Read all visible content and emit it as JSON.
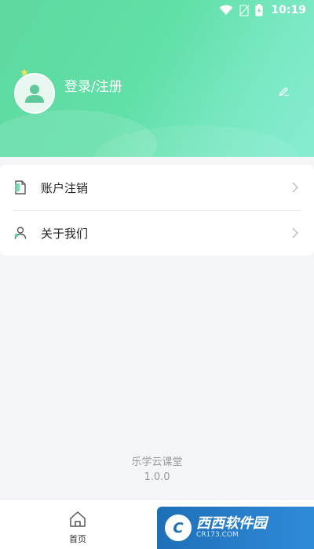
{
  "status": {
    "time": "10:19"
  },
  "profile": {
    "login_label": "登录/注册"
  },
  "menu": {
    "items": [
      {
        "label": "账户注销",
        "icon": "document-icon"
      },
      {
        "label": "关于我们",
        "icon": "user-icon"
      }
    ]
  },
  "app": {
    "name": "乐学云课堂",
    "version": "1.0.0"
  },
  "tabs": {
    "home_label": "首页"
  },
  "watermark": {
    "brand": "西西软件园",
    "domain": "CR173.COM"
  },
  "colors": {
    "header_green": "#60dfa6",
    "accent": "#5ed9a0"
  }
}
